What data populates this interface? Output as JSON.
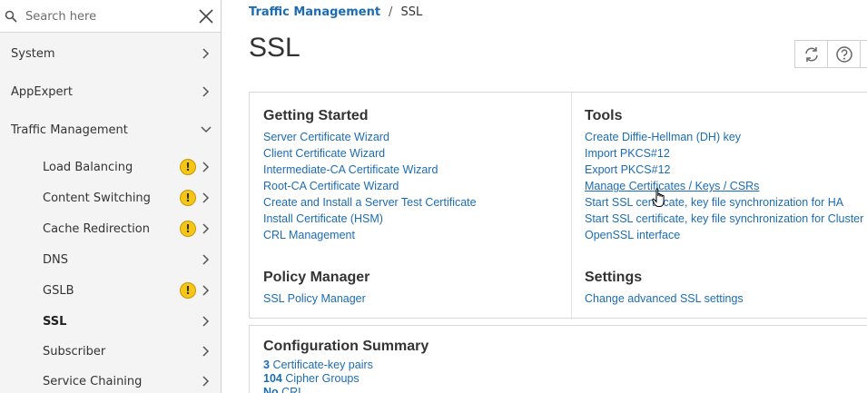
{
  "search": {
    "placeholder": "Search here"
  },
  "sidebar": {
    "items": [
      {
        "label": "System"
      },
      {
        "label": "AppExpert"
      },
      {
        "label": "Traffic Management"
      },
      {
        "label": "Load Balancing",
        "warning": true
      },
      {
        "label": "Content Switching",
        "warning": true
      },
      {
        "label": "Cache Redirection",
        "warning": true
      },
      {
        "label": "DNS"
      },
      {
        "label": "GSLB",
        "warning": true
      },
      {
        "label": "SSL",
        "active": true
      },
      {
        "label": "Subscriber"
      },
      {
        "label": "Service Chaining"
      }
    ],
    "warning_glyph": "!"
  },
  "breadcrumb": {
    "parent": "Traffic Management",
    "separator": "/",
    "current": "SSL"
  },
  "page": {
    "title": "SSL"
  },
  "toolbar": {
    "icons": [
      "refresh-icon",
      "help-icon"
    ]
  },
  "getting_started": {
    "title": "Getting Started",
    "links": [
      "Server Certificate Wizard",
      "Client Certificate Wizard",
      "Intermediate-CA Certificate Wizard",
      "Root-CA Certificate Wizard",
      "Create and Install a Server Test Certificate",
      "Install Certificate (HSM)",
      "CRL Management"
    ]
  },
  "tools": {
    "title": "Tools",
    "links": [
      "Create Diffie-Hellman (DH) key",
      "Import PKCS#12",
      "Export PKCS#12",
      "Manage Certificates / Keys / CSRs",
      "Start SSL certificate, key file synchronization for HA",
      "Start SSL certificate, key file synchronization for Cluster",
      "OpenSSL interface"
    ]
  },
  "policy_manager": {
    "title": "Policy Manager",
    "links": [
      "SSL Policy Manager"
    ]
  },
  "settings": {
    "title": "Settings",
    "links": [
      "Change advanced SSL settings"
    ]
  },
  "summary": {
    "title": "Configuration Summary",
    "lines": [
      {
        "count": "3",
        "label": "Certificate-key pairs"
      },
      {
        "count": "104",
        "label": "Cipher Groups"
      },
      {
        "count": "No",
        "label": "CRL"
      }
    ]
  },
  "colors": {
    "link": "#1c6cb3",
    "warning": "#f5c518",
    "sidebar_bg": "#f4f4f4"
  }
}
